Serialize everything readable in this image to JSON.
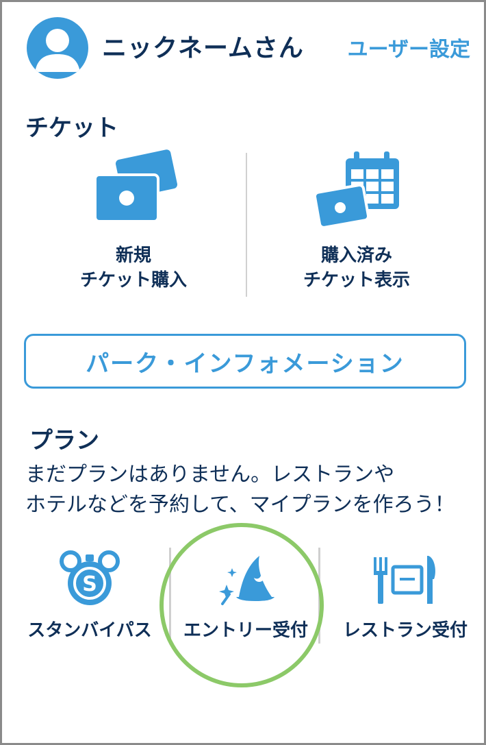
{
  "header": {
    "nickname": "ニックネームさん",
    "user_settings_label": "ユーザー設定"
  },
  "tickets": {
    "title": "チケット",
    "new_purchase": {
      "line1": "新規",
      "line2": "チケット購入"
    },
    "purchased_view": {
      "line1": "購入済み",
      "line2": "チケット表示"
    }
  },
  "park_info_label": "パーク・インフォメーション",
  "plans": {
    "title": "プラン",
    "message_line1": "まだプランはありません。レストランや",
    "message_line2": "ホテルなどを予約して、マイプランを作ろう！"
  },
  "services": [
    {
      "label": "スタンバイパス",
      "icon": "standby-pass-icon"
    },
    {
      "label": "エントリー受付",
      "icon": "wizard-hat-icon"
    },
    {
      "label": "レストラン受付",
      "icon": "restaurant-icon"
    }
  ],
  "colors": {
    "accent": "#3a9ad9",
    "text_dark": "#0f2f57",
    "highlight": "#8cc968",
    "divider": "#cfcfcf"
  }
}
